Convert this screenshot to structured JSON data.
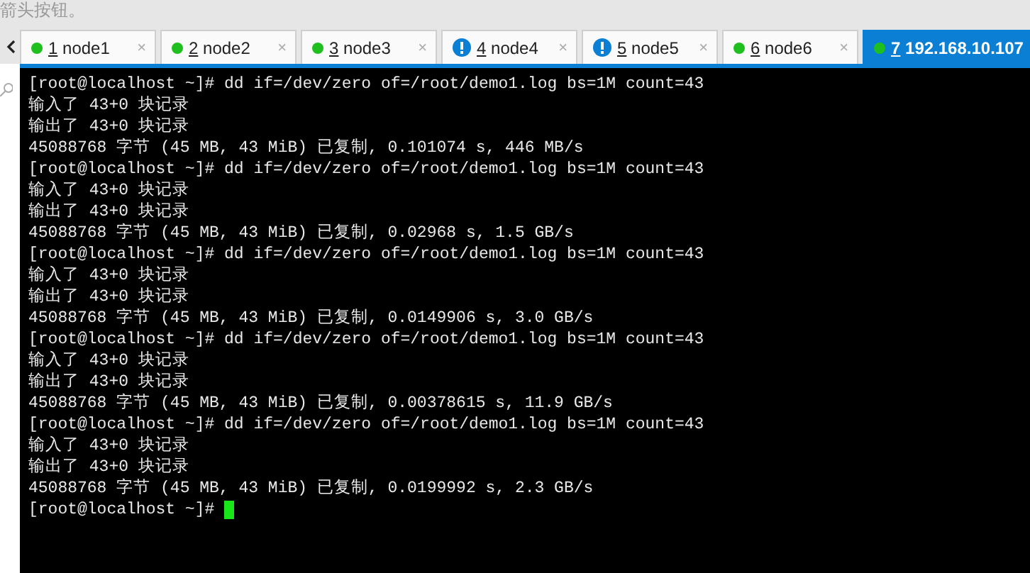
{
  "hint_text": "箭头按钮。",
  "tabs": [
    {
      "number": "1",
      "label": "node1",
      "kind": "ok",
      "close": "×",
      "selected": false
    },
    {
      "number": "2",
      "label": "node2",
      "kind": "ok",
      "close": "×",
      "selected": false
    },
    {
      "number": "3",
      "label": "node3",
      "kind": "ok",
      "close": "×",
      "selected": false
    },
    {
      "number": "4",
      "label": "node4",
      "kind": "alert",
      "close": "×",
      "selected": false
    },
    {
      "number": "5",
      "label": "node5",
      "kind": "alert",
      "close": "×",
      "selected": false
    },
    {
      "number": "6",
      "label": "node6",
      "kind": "ok",
      "close": "×",
      "selected": false
    },
    {
      "number": "7",
      "label": "192.168.10.107",
      "kind": "ok",
      "selected": true
    }
  ],
  "terminal": {
    "lines": [
      "[root@localhost ~]# dd if=/dev/zero of=/root/demo1.log bs=1M count=43",
      "输入了 43+0 块记录",
      "输出了 43+0 块记录",
      "45088768 字节 (45 MB, 43 MiB) 已复制, 0.101074 s, 446 MB/s",
      "[root@localhost ~]# dd if=/dev/zero of=/root/demo1.log bs=1M count=43",
      "输入了 43+0 块记录",
      "输出了 43+0 块记录",
      "45088768 字节 (45 MB, 43 MiB) 已复制, 0.02968 s, 1.5 GB/s",
      "[root@localhost ~]# dd if=/dev/zero of=/root/demo1.log bs=1M count=43",
      "输入了 43+0 块记录",
      "输出了 43+0 块记录",
      "45088768 字节 (45 MB, 43 MiB) 已复制, 0.0149906 s, 3.0 GB/s",
      "[root@localhost ~]# dd if=/dev/zero of=/root/demo1.log bs=1M count=43",
      "输入了 43+0 块记录",
      "输出了 43+0 块记录",
      "45088768 字节 (45 MB, 43 MiB) 已复制, 0.00378615 s, 11.9 GB/s",
      "[root@localhost ~]# dd if=/dev/zero of=/root/demo1.log bs=1M count=43",
      "输入了 43+0 块记录",
      "输出了 43+0 块记录",
      "45088768 字节 (45 MB, 43 MiB) 已复制, 0.0199992 s, 2.3 GB/s"
    ],
    "prompt": "[root@localhost ~]#",
    "cursor": true
  }
}
